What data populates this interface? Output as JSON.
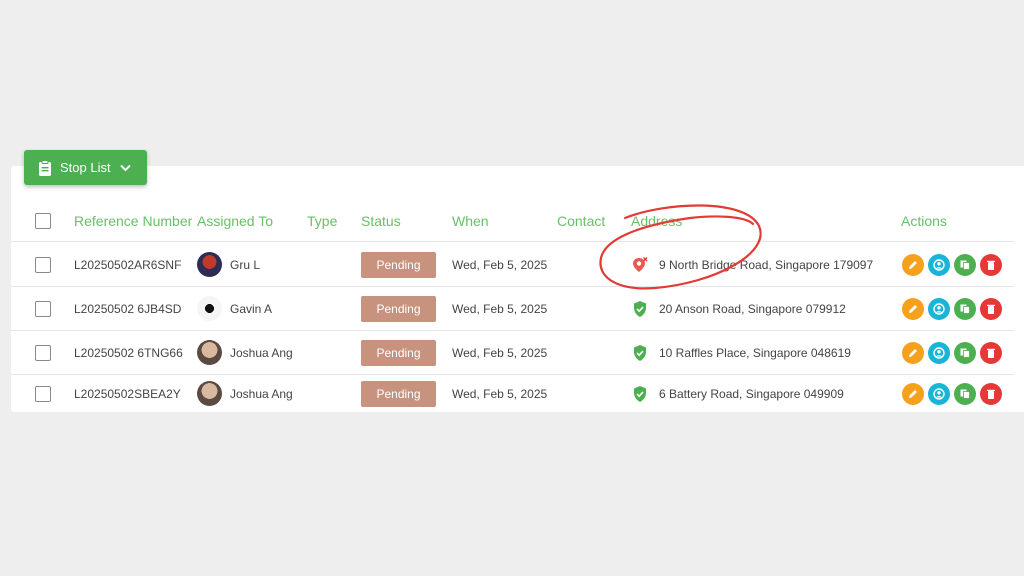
{
  "toolbar": {
    "stop_list_label": "Stop List"
  },
  "table": {
    "headers": {
      "reference": "Reference Number",
      "assigned": "Assigned To",
      "type": "Type",
      "status": "Status",
      "when": "When",
      "contact": "Contact",
      "address": "Address",
      "actions": "Actions"
    },
    "rows": [
      {
        "reference": "L20250502AR6SNF",
        "assigned": "Gru L",
        "type": "",
        "status": "Pending",
        "when": "Wed, Feb 5, 2025",
        "contact": "",
        "address": "9 North Bridge Road, Singapore 179097",
        "address_icon": "location-error-icon"
      },
      {
        "reference": "L20250502 6JB4SD",
        "assigned": "Gavin A",
        "type": "",
        "status": "Pending",
        "when": "Wed, Feb 5, 2025",
        "contact": "",
        "address": "20 Anson Road, Singapore 079912",
        "address_icon": "verified-shield-icon"
      },
      {
        "reference": "L20250502 6TNG66",
        "assigned": "Joshua Ang",
        "type": "",
        "status": "Pending",
        "when": "Wed, Feb 5, 2025",
        "contact": "",
        "address": "10 Raffles Place, Singapore 048619",
        "address_icon": "verified-shield-icon"
      },
      {
        "reference": "L20250502SBEA2Y",
        "assigned": "Joshua Ang",
        "type": "",
        "status": "Pending",
        "when": "Wed, Feb 5, 2025",
        "contact": "",
        "address": "6 Battery Road, Singapore 049909",
        "address_icon": "verified-shield-icon"
      }
    ]
  },
  "colors": {
    "accent_green": "#4caf50",
    "status_pending": "#c7927e",
    "edit": "#f5a11c",
    "user": "#1ab5d6",
    "copy": "#4caf50",
    "delete": "#e53935",
    "annotation_red": "#e53935"
  }
}
